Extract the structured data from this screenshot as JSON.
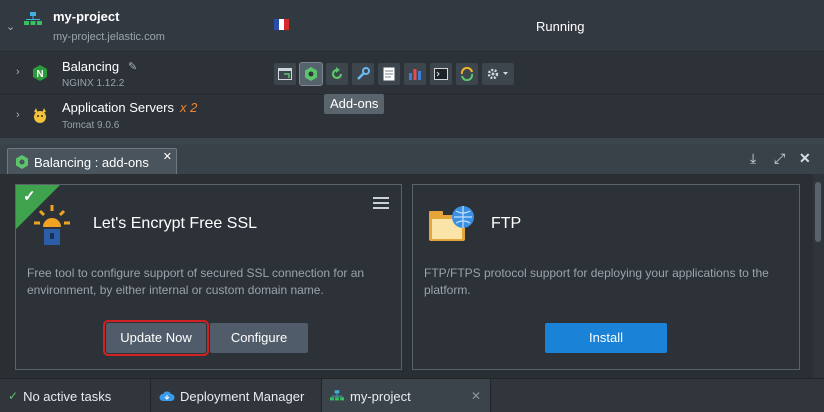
{
  "environment": {
    "name": "my-project",
    "url": "my-project.jelastic.com",
    "status": "Running",
    "region_flag": "France"
  },
  "nodes": [
    {
      "name": "Balancing",
      "version": "NGINX 1.12.2"
    },
    {
      "name": "Application Servers",
      "count": "x 2",
      "version": "Tomcat 9.0.6"
    }
  ],
  "toolbar": {
    "icons": [
      "open-in-browser-icon",
      "add-ons-icon",
      "restart-icon",
      "config-icon",
      "log-icon",
      "statistics-icon",
      "web-ssh-icon",
      "redeploy-icon",
      "settings-icon"
    ],
    "tooltip": "Add-ons"
  },
  "panel": {
    "tab_label": "Balancing : add-ons"
  },
  "addons": [
    {
      "title": "Let's Encrypt Free SSL",
      "description": "Free tool to configure support of secured SSL connection for an environment, by either internal or custom domain name.",
      "installed": true,
      "update_label": "Update Now",
      "configure_label": "Configure"
    },
    {
      "title": "FTP",
      "description": "FTP/FTPS protocol support for deploying your applications to the platform.",
      "install_label": "Install"
    }
  ],
  "statusbar": {
    "tasks": "No active tasks",
    "deployment_manager": "Deployment Manager",
    "env_tab": "my-project"
  },
  "colors": {
    "install_button": "#1a83d8",
    "installed_ribbon": "#3fa34d",
    "highlight": "#d32020",
    "count_accent": "#f0842c"
  }
}
